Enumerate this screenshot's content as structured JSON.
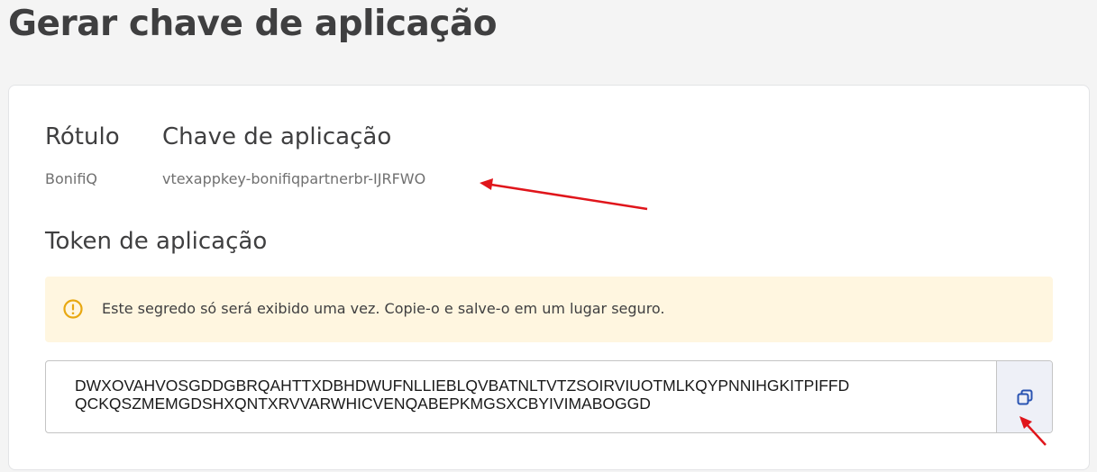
{
  "page": {
    "title": "Gerar chave de aplicação"
  },
  "table": {
    "headers": {
      "label": "Rótulo",
      "key": "Chave de aplicação"
    },
    "row": {
      "label": "BonifiQ",
      "key": "vtexappkey-bonifiqpartnerbr-IJRFWO"
    }
  },
  "token": {
    "title": "Token de aplicação",
    "warning": "Este segredo só será exibido uma vez. Copie-o e salve-o em um lugar seguro.",
    "line1": "DWXOVAHVOSGDDGBRQAHTTXDBHDWUFNLLIEBLQVBATNLTVTZSOIRVIUOTMLKQYPNNIHGKITPIFFD",
    "line2": "QCKQSZMEMGDSHXQNTXRVVARWHICVENQABEPKMGSXCBYIVIMABOGGD"
  },
  "icons": {
    "warning": "warning-circle-icon",
    "copy": "copy-icon"
  },
  "colors": {
    "accent": "#2953b2",
    "warning_bg": "#fff6e0",
    "warning_icon": "#e8a812",
    "annotation": "#e0151b"
  }
}
